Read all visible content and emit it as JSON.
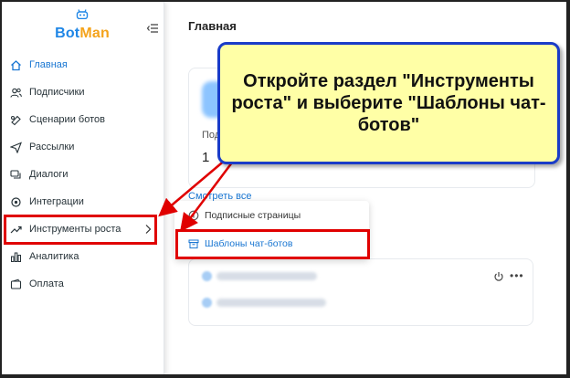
{
  "app": {
    "brand_part1": "Bot",
    "brand_part2": "Man"
  },
  "sidebar": {
    "items": [
      {
        "label": "Главная",
        "icon": "home-icon"
      },
      {
        "label": "Подписчики",
        "icon": "users-icon"
      },
      {
        "label": "Сценарии ботов",
        "icon": "bot-scenarios-icon"
      },
      {
        "label": "Рассылки",
        "icon": "send-icon"
      },
      {
        "label": "Диалоги",
        "icon": "chat-icon"
      },
      {
        "label": "Интеграции",
        "icon": "integrations-icon"
      },
      {
        "label": "Инструменты роста",
        "icon": "trending-up-icon"
      },
      {
        "label": "Аналитика",
        "icon": "bar-chart-icon"
      },
      {
        "label": "Оплата",
        "icon": "wallet-icon"
      }
    ]
  },
  "main": {
    "title": "Главная",
    "card_label": "Под",
    "card_value": "1",
    "see_all": "Смотреть все"
  },
  "dropdown": {
    "items": [
      {
        "label": "Подписные страницы",
        "icon": "info-circle-icon"
      },
      {
        "label": "Шаблоны чат-ботов",
        "icon": "archive-box-icon"
      }
    ]
  },
  "annotation": {
    "callout_text": "Откройте раздел \"Инструменты роста\" и выберите \"Шаблоны чат-ботов\""
  },
  "colors": {
    "accent": "#1976d2",
    "brand_blue": "#1f86e6",
    "brand_orange": "#f4a31b",
    "callout_bg": "#ffffa6",
    "callout_border": "#1a3cc8",
    "highlight_red": "#e00000"
  }
}
